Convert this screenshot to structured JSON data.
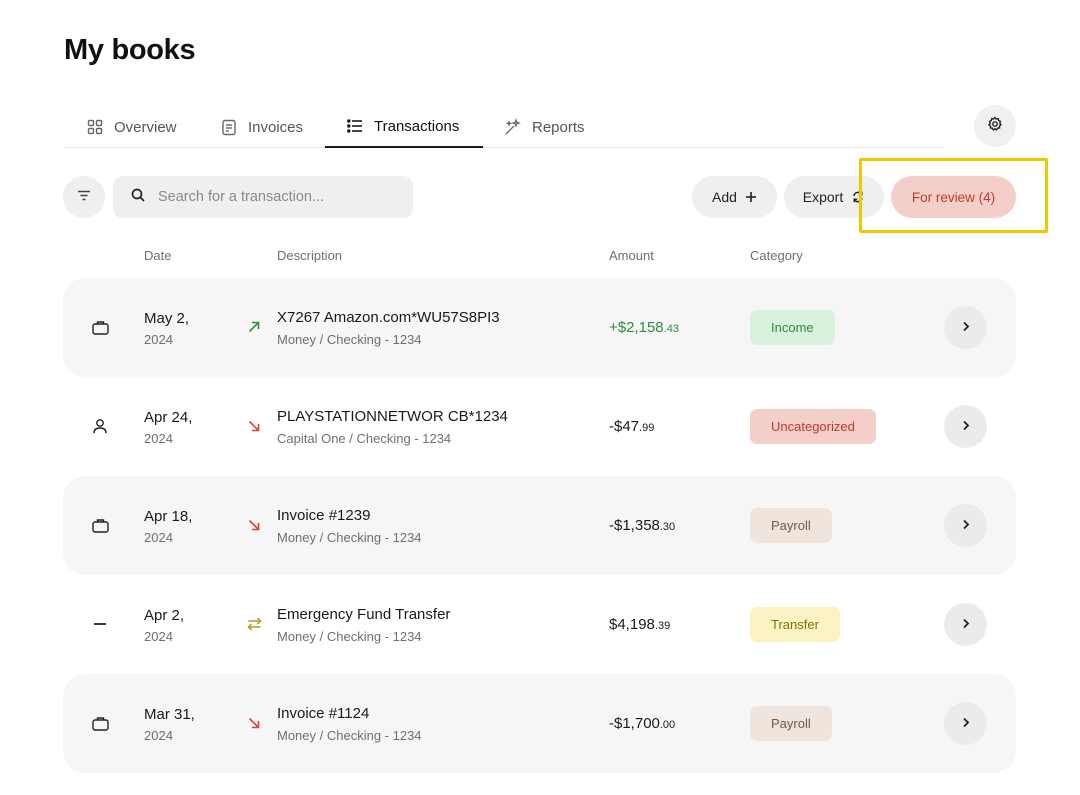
{
  "page": {
    "title": "My books"
  },
  "tabs": [
    {
      "label": "Overview",
      "icon": "grid-icon",
      "active": false
    },
    {
      "label": "Invoices",
      "icon": "document-icon",
      "active": false
    },
    {
      "label": "Transactions",
      "icon": "list-icon",
      "active": true
    },
    {
      "label": "Reports",
      "icon": "sparkle-icon",
      "active": false
    }
  ],
  "toolbar": {
    "search_placeholder": "Search for a transaction...",
    "add_label": "Add",
    "export_label": "Export",
    "review_label": "For review (4)"
  },
  "columns": {
    "date": "Date",
    "description": "Description",
    "amount": "Amount",
    "category": "Category"
  },
  "transactions": [
    {
      "type_icon": "briefcase-icon",
      "date": "May 2,",
      "year": "2024",
      "direction": "inflow-arrow-icon",
      "description": "X7267 Amazon.com*WU57S8PI3",
      "account": "Money / Checking - 1234",
      "amount_main": "+$2,158",
      "amount_cents": ".43",
      "category": "Income"
    },
    {
      "type_icon": "person-icon",
      "date": "Apr 24,",
      "year": "2024",
      "direction": "outflow-arrow-icon",
      "description": "PLAYSTATIONNETWOR CB*1234",
      "account": "Capital One / Checking - 1234",
      "amount_main": "-$47",
      "amount_cents": ".99",
      "category": "Uncategorized"
    },
    {
      "type_icon": "briefcase-icon",
      "date": "Apr 18,",
      "year": "2024",
      "direction": "outflow-arrow-icon",
      "description": "Invoice #1239",
      "account": "Money / Checking - 1234",
      "amount_main": "-$1,358",
      "amount_cents": ".30",
      "category": "Payroll"
    },
    {
      "type_icon": "dash-icon",
      "date": "Apr 2,",
      "year": "2024",
      "direction": "transfer-arrows-icon",
      "description": "Emergency Fund Transfer",
      "account": "Money / Checking - 1234",
      "amount_main": "$4,198",
      "amount_cents": ".39",
      "category": "Transfer"
    },
    {
      "type_icon": "briefcase-icon",
      "date": "Mar 31,",
      "year": "2024",
      "direction": "outflow-arrow-icon",
      "description": "Invoice #1124",
      "account": "Money / Checking - 1234",
      "amount_main": "-$1,700",
      "amount_cents": ".00",
      "category": "Payroll"
    }
  ],
  "colors": {
    "income": "#2e8b3e",
    "review": "#c0392b",
    "highlight": "#f2c600"
  }
}
